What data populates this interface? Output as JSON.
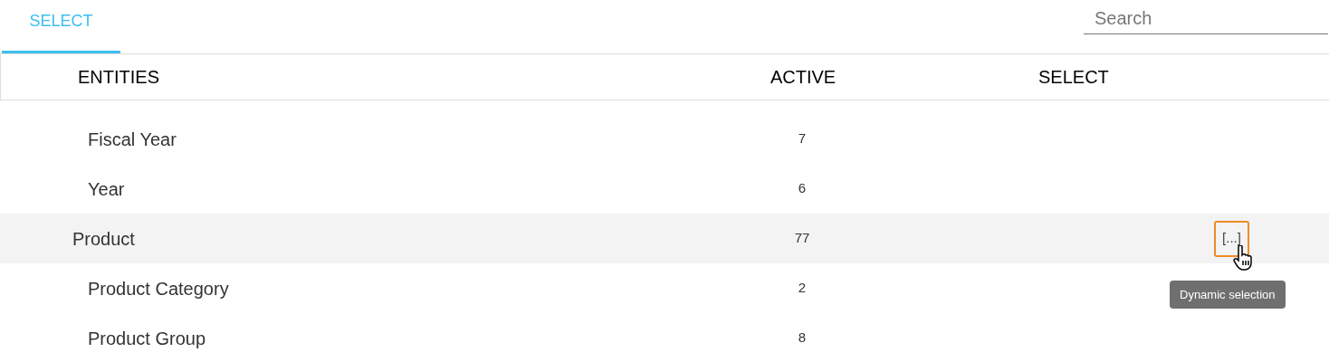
{
  "tabs": [
    {
      "label": "SELECT",
      "selected": true
    }
  ],
  "search": {
    "placeholder": "Search"
  },
  "table": {
    "columns": [
      "ENTITIES",
      "ACTIVE",
      "SELECT"
    ],
    "rows": [
      {
        "kind": "sub",
        "name": "Fiscal Year",
        "active": "7",
        "hovered": false
      },
      {
        "kind": "sub",
        "name": "Year",
        "active": "6",
        "hovered": false
      },
      {
        "kind": "group",
        "name": "Product",
        "active": "77",
        "hovered": true,
        "select_button": "[...]",
        "tooltip": "Dynamic selection",
        "children": [
          {
            "kind": "sub",
            "name": "Product Category",
            "active": "2",
            "hovered": false
          },
          {
            "kind": "sub",
            "name": "Product Group",
            "active": "8",
            "hovered": false
          }
        ]
      }
    ]
  }
}
